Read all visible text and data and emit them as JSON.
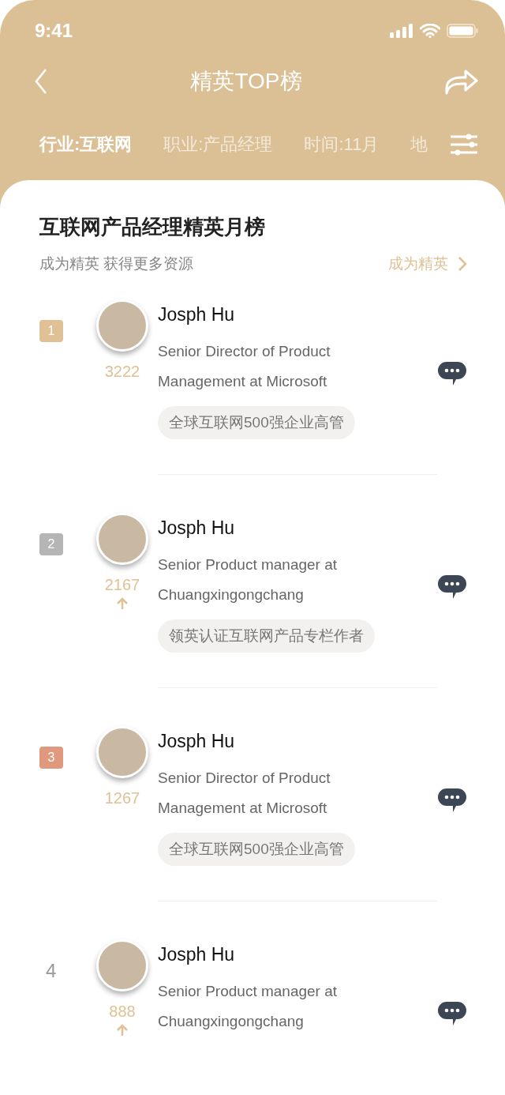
{
  "status_bar": {
    "time": "9:41"
  },
  "nav": {
    "title": "精英TOP榜"
  },
  "filters": [
    {
      "label": "行业:互联网",
      "selected": true
    },
    {
      "label": "职业:产品经理",
      "selected": false
    },
    {
      "label": "时间:11月",
      "selected": false
    },
    {
      "label": "地",
      "selected": false
    }
  ],
  "board": {
    "title": "互联网产品经理精英月榜",
    "subtitle": "成为精英 获得更多资源",
    "link": "成为精英"
  },
  "rows": [
    {
      "rank": "1",
      "kind": "badge",
      "color": "#dfc195",
      "score": "3222",
      "rising": false,
      "name": "Josph Hu",
      "description": "Senior Director of Product Management at Microsoft",
      "tag": "全球互联网500强企业高管"
    },
    {
      "rank": "2",
      "kind": "badge",
      "color": "#b5b5b5",
      "score": "2167",
      "rising": true,
      "name": "Josph Hu",
      "description": "Senior Product manager at Chuangxingongchang",
      "tag": "领英认证互联网产品专栏作者"
    },
    {
      "rank": "3",
      "kind": "badge",
      "color": "#e0997d",
      "score": "1267",
      "rising": false,
      "name": "Josph Hu",
      "description": "Senior Director of Product Management at Microsoft",
      "tag": "全球互联网500强企业高管"
    },
    {
      "rank": "4",
      "kind": "plain",
      "score": "888",
      "rising": true,
      "name": "Josph Hu",
      "description": "Senior Product manager at Chuangxingongchang"
    }
  ]
}
